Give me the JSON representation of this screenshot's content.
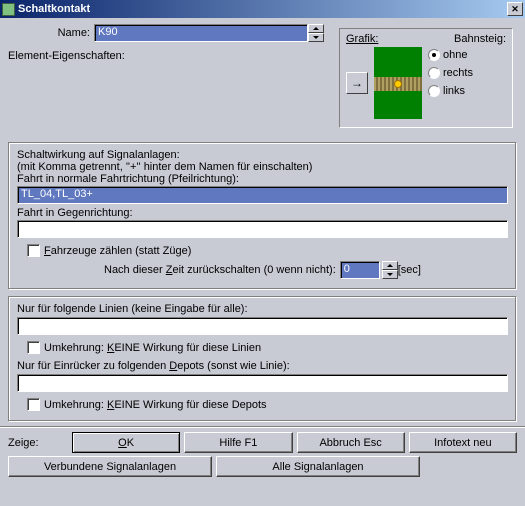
{
  "title": "Schaltkontakt",
  "top": {
    "name_lbl": "Name:",
    "name_val": "K90",
    "elem_lbl": "Element-Eigenschaften:"
  },
  "grafik": {
    "grafik_lbl": "Grafik:",
    "bahnsteig_lbl": "Bahnsteig:",
    "opts": {
      "ohne": "ohne",
      "rechts": "rechts",
      "links": "links"
    }
  },
  "sig": {
    "hdr": "Schaltwirkung auf Signalanlagen:",
    "hint": "(mit Komma getrennt, ''+'' hinter dem Namen für einschalten)",
    "fwd_lbl": "Fahrt in normale Fahrtrichtung (Pfeilrichtung):",
    "fwd_val": "TL_04,TL_03+",
    "rev_lbl": "Fahrt in Gegenrichtung:",
    "rev_val": "",
    "count_lbl": "Fahrzeuge zählen (statt Züge)",
    "delay_lbl1": "Nach dieser ",
    "delay_lbl_u": "Z",
    "delay_lbl2": "eit zurückschalten (0 wenn nicht):",
    "delay_val": "0",
    "sec": " [sec]"
  },
  "lines": {
    "hdr": "Nur für folgende Linien (keine Eingabe für alle):",
    "val1": "",
    "u1a": "Umkehrung: ",
    "u1u": "K",
    "u1b": "EINE Wirkung für diese Linien",
    "depot_lbl1": "Nur für Einrücker zu folgenden ",
    "depot_u": "D",
    "depot_lbl2": "epots (sonst wie Linie):",
    "val2": "",
    "u2a": "Umkehrung: ",
    "u2u": "K",
    "u2b": "EINE Wirkung für diese Depots"
  },
  "btns": {
    "zeige": "Zeige:",
    "ok_u": "O",
    "ok": "K",
    "hilfe": "Hilfe   F1",
    "abbruch": "Abbruch  Esc",
    "infotext": "Infotext neu",
    "verb": "Verbundene Signalanlagen",
    "alle": "Alle Signalanlagen"
  }
}
